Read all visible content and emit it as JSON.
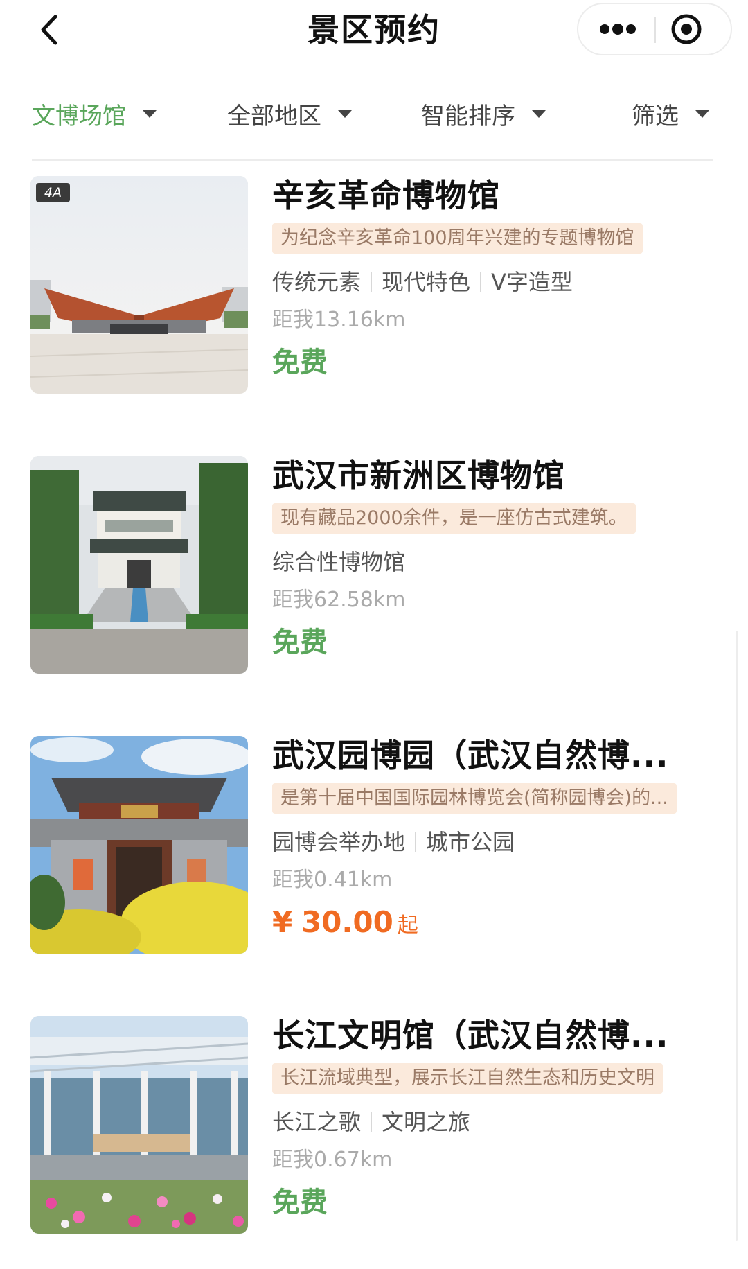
{
  "header": {
    "title": "景区预约",
    "back_icon": "chevron-left-icon",
    "more_icon": "more-dots-icon",
    "close_icon": "target-close-icon"
  },
  "filters": [
    {
      "label": "文博场馆",
      "active": true
    },
    {
      "label": "全部地区",
      "active": false
    },
    {
      "label": "智能排序",
      "active": false
    },
    {
      "label": "筛选",
      "active": false
    }
  ],
  "colors": {
    "accent_green": "#5aa65b",
    "price_orange": "#f06b22",
    "desc_background": "#fbeadc",
    "desc_text": "#9a7a66"
  },
  "items": [
    {
      "title": "辛亥革命博物馆",
      "badge": "4A",
      "description": "为纪念辛亥革命100周年兴建的专题博物馆",
      "tags": [
        "传统元素",
        "现代特色",
        "V字造型"
      ],
      "distance": "距我13.16km",
      "price": "免费"
    },
    {
      "title": "武汉市新洲区博物馆",
      "description": "现有藏品2000余件，是一座仿古式建筑。",
      "tags": [
        "综合性博物馆"
      ],
      "distance": "距我62.58km",
      "price": "免费"
    },
    {
      "title": "武汉园博园（武汉自然博...",
      "description": "是第十届中国国际园林博览会(简称园博会)的...",
      "tags": [
        "园博会举办地",
        "城市公园"
      ],
      "distance": "距我0.41km",
      "price_symbol": "¥",
      "price_value": "30.00",
      "price_suffix": "起"
    },
    {
      "title": "长江文明馆（武汉自然博...",
      "description": "长江流域典型，展示长江自然生态和历史文明",
      "tags": [
        "长江之歌",
        "文明之旅"
      ],
      "distance": "距我0.67km",
      "price": "免费"
    }
  ]
}
